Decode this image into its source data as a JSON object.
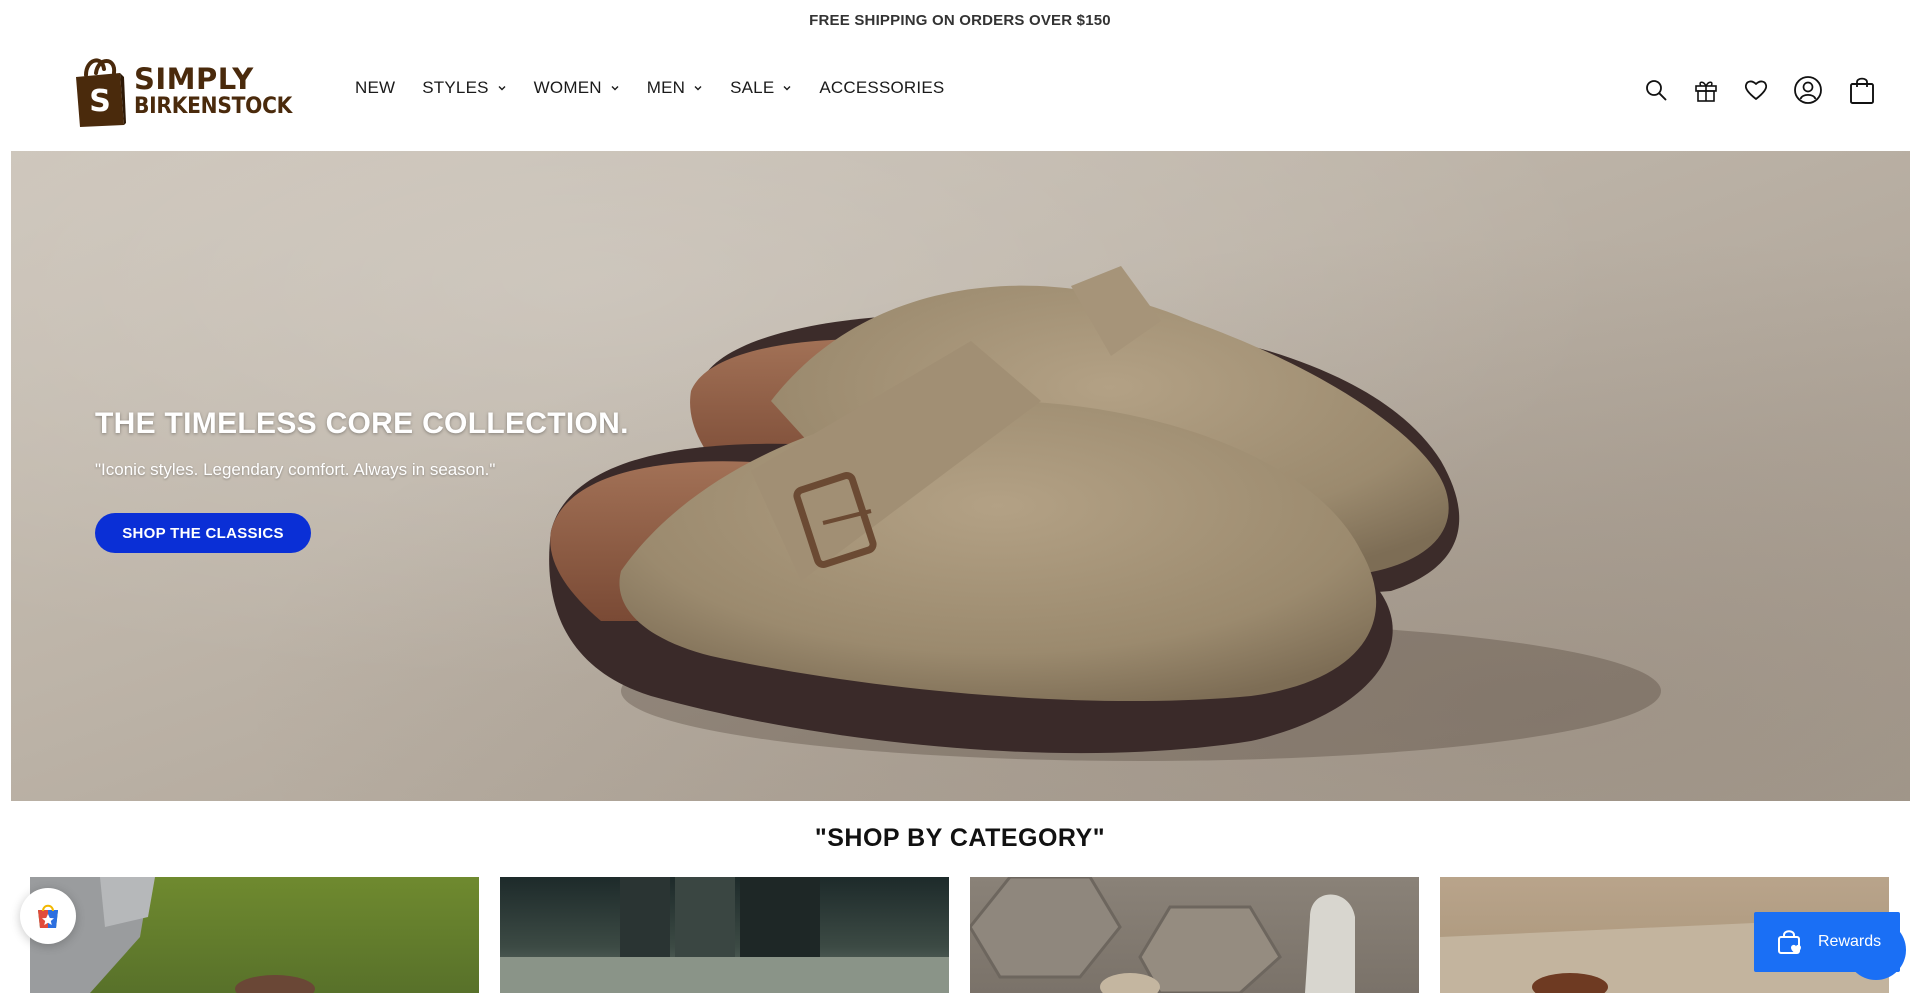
{
  "announcement": {
    "text": "FREE SHIPPING ON ORDERS OVER $150"
  },
  "logo": {
    "line1": "SIMPLY",
    "line2": "BIRKENSTOCK",
    "bag_letter": "S",
    "icon": "shopping-bag-logo",
    "color": "#4a2a0c"
  },
  "nav": {
    "items": [
      {
        "label": "NEW",
        "has_dropdown": false
      },
      {
        "label": "STYLES",
        "has_dropdown": true
      },
      {
        "label": "WOMEN",
        "has_dropdown": true
      },
      {
        "label": "MEN",
        "has_dropdown": true
      },
      {
        "label": "SALE",
        "has_dropdown": true
      },
      {
        "label": "ACCESSORIES",
        "has_dropdown": false
      }
    ]
  },
  "header_icons": [
    "search-icon",
    "gift-icon",
    "heart-icon",
    "account-icon",
    "cart-icon"
  ],
  "hero": {
    "title": "THE TIMELESS CORE COLLECTION.",
    "subtitle": "\"Iconic styles. Legendary comfort. Always in season.\"",
    "cta_label": "SHOP THE CLASSICS",
    "cta_color": "#0a2fd6"
  },
  "categories": {
    "title": "\"SHOP BY CATEGORY\""
  },
  "rewards": {
    "label": "Rewards",
    "color": "#1a6ff5"
  }
}
